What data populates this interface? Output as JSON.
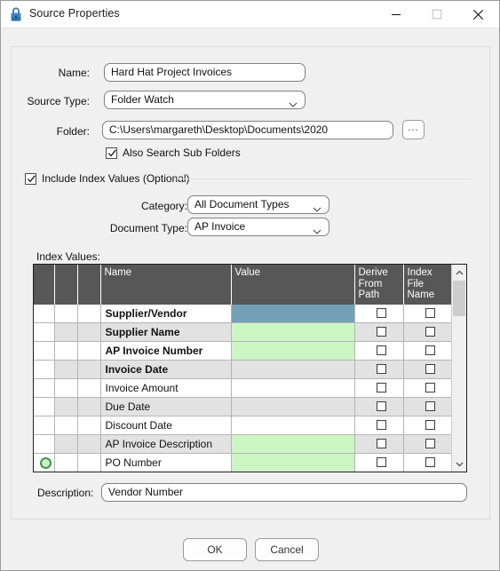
{
  "window": {
    "title": "Source Properties",
    "icon": "lock-icon",
    "controls": {
      "minimize": "minimize-icon",
      "maximize": "maximize-icon",
      "close": "close-icon"
    }
  },
  "form": {
    "name_label": "Name:",
    "name_value": "Hard Hat Project Invoices",
    "source_type_label": "Source Type:",
    "source_type_value": "Folder Watch",
    "folder_label": "Folder:",
    "folder_value": "C:\\Users\\margareth\\Desktop\\Documents\\2020",
    "browse_label": "...",
    "sub_folders_label": "Also Search Sub Folders",
    "sub_folders_checked": true
  },
  "index_group": {
    "title": "Include Index Values (Optional)",
    "checked": true,
    "category_label": "Category:",
    "category_value": "All Document Types",
    "document_type_label": "Document Type:",
    "document_type_value": "AP Invoice"
  },
  "grid": {
    "label": "Index Values:",
    "columns": [
      "",
      "",
      "",
      "Name",
      "Value",
      "Derive From Path",
      "Index File Name"
    ],
    "rows": [
      {
        "name": "Supplier/Vendor",
        "bold": true,
        "value": "",
        "value_state": "selected",
        "derive_from_path": false,
        "index_file_name": false,
        "icon": ""
      },
      {
        "name": "Supplier Name",
        "bold": true,
        "value": "",
        "value_state": "green",
        "derive_from_path": false,
        "index_file_name": false,
        "icon": ""
      },
      {
        "name": "AP Invoice Number",
        "bold": true,
        "value": "",
        "value_state": "green",
        "derive_from_path": false,
        "index_file_name": false,
        "icon": ""
      },
      {
        "name": "Invoice Date",
        "bold": true,
        "value": "",
        "value_state": "none",
        "derive_from_path": false,
        "index_file_name": false,
        "icon": ""
      },
      {
        "name": "Invoice Amount",
        "bold": false,
        "value": "",
        "value_state": "none",
        "derive_from_path": false,
        "index_file_name": false,
        "icon": ""
      },
      {
        "name": "Due Date",
        "bold": false,
        "value": "",
        "value_state": "none",
        "derive_from_path": false,
        "index_file_name": false,
        "icon": ""
      },
      {
        "name": "Discount Date",
        "bold": false,
        "value": "",
        "value_state": "none",
        "derive_from_path": false,
        "index_file_name": false,
        "icon": ""
      },
      {
        "name": "AP Invoice Description",
        "bold": false,
        "value": "",
        "value_state": "green",
        "derive_from_path": false,
        "index_file_name": false,
        "icon": ""
      },
      {
        "name": "PO Number",
        "bold": false,
        "value": "",
        "value_state": "green",
        "derive_from_path": false,
        "index_file_name": false,
        "icon": "green-circle-icon"
      }
    ]
  },
  "description": {
    "label": "Description:",
    "value": "Vendor Number"
  },
  "footer": {
    "ok_label": "OK",
    "cancel_label": "Cancel"
  },
  "colors": {
    "selected_cell": "#74a0b7",
    "green_cell": "#ccf5c4",
    "header_bg": "#575757",
    "alt_row": "#e2e2e2"
  }
}
